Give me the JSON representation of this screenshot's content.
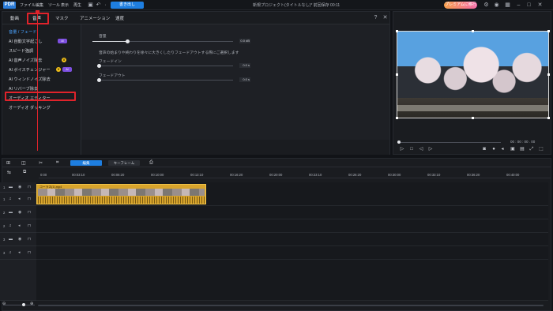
{
  "titlebar": {
    "app_logo": "PDR",
    "menus": [
      "ファイル",
      "編集",
      "ツール",
      "表示",
      "再生"
    ],
    "export_label": "書き出し",
    "window_title": "新規プロジェクト(タイトルなし)* 前回保存 00:11",
    "promo_label": "プレミアムに移行"
  },
  "left_panel": {
    "tabs": [
      "動画",
      "音声",
      "マスク",
      "アニメーション",
      "速度"
    ],
    "active_tab": "音声",
    "subnav": [
      {
        "label": "音量 / フェード",
        "active": true
      },
      {
        "label": "AI 自動文字起こし",
        "badge": "AI"
      },
      {
        "label": "スピード強調"
      },
      {
        "label": "AI 音声ノイズ除去",
        "badge": "crown"
      },
      {
        "label": "AI ボイスチェンジャー",
        "badge": "AI"
      },
      {
        "label": "AI ウィンドノイズ除去"
      },
      {
        "label": "AI リバーブ除去"
      },
      {
        "label": "オーディオ エディター",
        "highlighted": true
      },
      {
        "label": "オーディオ ダッキング"
      }
    ],
    "volume": {
      "label": "音量",
      "value": "0.0 dB",
      "level": 0.6
    },
    "fade_note": "音声の始まりや終わりを徐々に大きくしたりフェードアウトする際にご選択します",
    "fade_in": {
      "label": "フェードイン",
      "value": "0.0 s"
    },
    "fade_out": {
      "label": "フェードアウト",
      "value": "0.0 s"
    }
  },
  "preview": {
    "timecode": "00 : 00 : 00 . 00"
  },
  "timeline": {
    "mode_buttons": [
      "編集",
      "キーフレーム"
    ],
    "active_mode": "編集",
    "ticks": [
      "0:00",
      "00:03:10",
      "00:06:20",
      "00:10:00",
      "00:13:10",
      "00:16:20",
      "00:20:00",
      "00:23:10",
      "00:26:20",
      "00:30:00",
      "00:33:10",
      "00:36:20",
      "00:40:00"
    ],
    "tracks": [
      "1",
      "1",
      "2",
      "2",
      "3",
      "3"
    ],
    "clip_label": "コーラス(1).mp4"
  }
}
